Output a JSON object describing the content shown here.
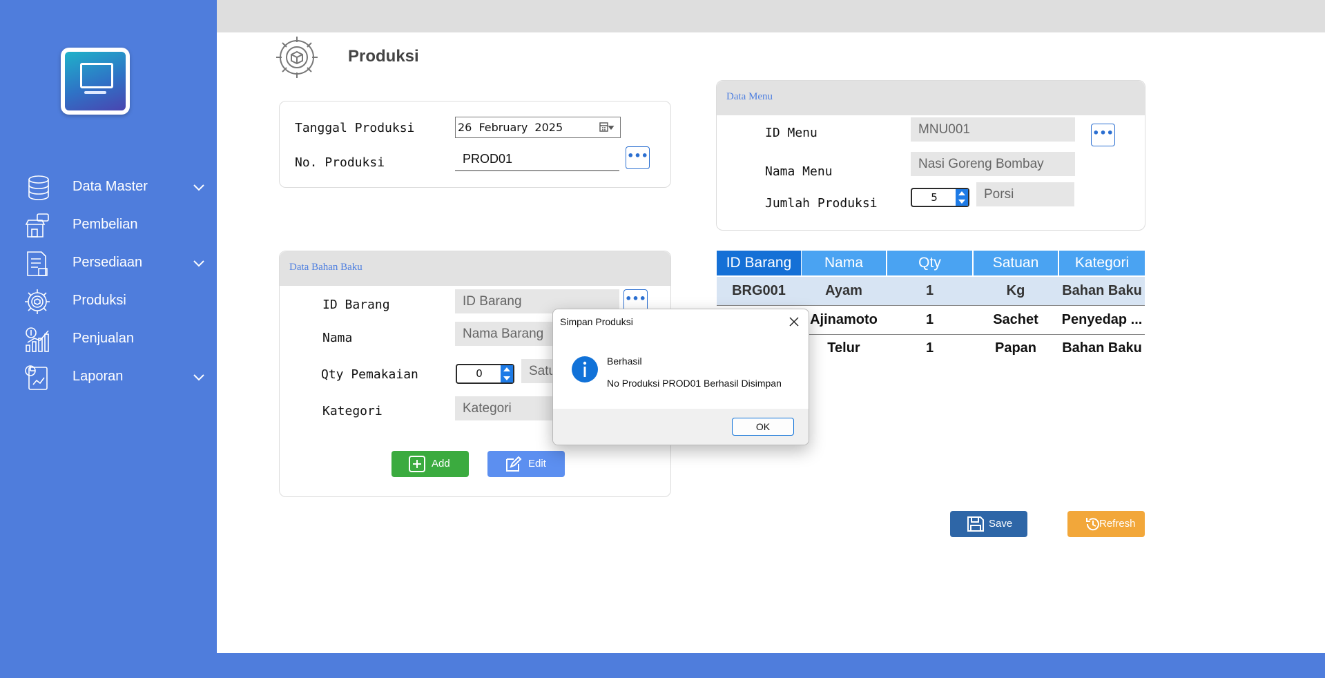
{
  "sidebar": {
    "items": [
      {
        "label": "Data Master",
        "icon": "database-icon",
        "expandable": true
      },
      {
        "label": "Pembelian",
        "icon": "store-buy-icon",
        "expandable": false
      },
      {
        "label": "Persediaan",
        "icon": "inventory-document-icon",
        "expandable": true
      },
      {
        "label": "Produksi",
        "icon": "gear-box-icon",
        "expandable": false
      },
      {
        "label": "Penjualan",
        "icon": "sales-chart-icon",
        "expandable": false
      },
      {
        "label": "Laporan",
        "icon": "report-icon",
        "expandable": true
      }
    ]
  },
  "page": {
    "title": "Produksi"
  },
  "production": {
    "date_label": "Tanggal Produksi",
    "date_value": "26 February 2025",
    "number_label": "No. Produksi",
    "number_value": "PROD01",
    "lookup_label": "•••"
  },
  "menu_panel": {
    "title": "Data Menu",
    "id_label": "ID Menu",
    "id_value": "MNU001",
    "name_label": "Nama Menu",
    "name_value": "Nasi Goreng Bombay",
    "qty_label": "Jumlah Produksi",
    "qty_value": "5",
    "unit_value": "Porsi"
  },
  "material_panel": {
    "title": "Data Bahan Baku",
    "id_label": "ID Barang",
    "id_value": "ID Barang",
    "name_label": "Nama",
    "name_value": "Nama Barang",
    "qty_label": "Qty Pemakaian",
    "qty_value": "0",
    "unit_value": "Satu",
    "category_label": "Kategori",
    "category_value": "Kategori",
    "add_label": "Add",
    "edit_label": "Edit"
  },
  "table": {
    "headers": [
      "ID Barang",
      "Nama",
      "Qty",
      "Satuan",
      "Kategori"
    ],
    "rows": [
      [
        "BRG001",
        "Ayam",
        "1",
        "Kg",
        "Bahan Baku"
      ],
      [
        "",
        "Ajinamoto",
        "1",
        "Sachet",
        "Penyedap ..."
      ],
      [
        "",
        "Telur",
        "1",
        "Papan",
        "Bahan Baku"
      ]
    ]
  },
  "actions": {
    "save_label": "Save",
    "refresh_label": "Refresh"
  },
  "dialog": {
    "title": "Simpan Produksi",
    "heading": "Berhasil",
    "message": "No Produksi PROD01 Berhasil Disimpan",
    "ok_label": "OK"
  },
  "colors": {
    "sidebar": "#4f7ddc",
    "table_header_first": "#1570d6",
    "table_header": "#4aa3f2",
    "add_button": "#3bab3f",
    "edit_button": "#5c8ff0",
    "save_button": "#2e66a7",
    "refresh_button": "#f2a73a"
  }
}
